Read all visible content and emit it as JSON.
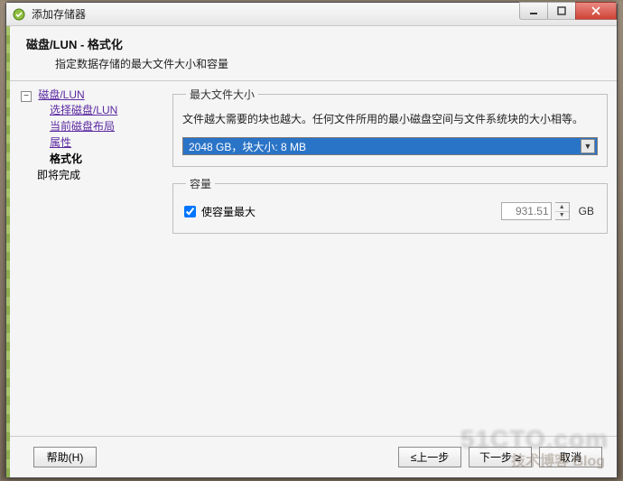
{
  "window": {
    "title": "添加存储器"
  },
  "header": {
    "title": "磁盘/LUN - 格式化",
    "subtitle": "指定数据存储的最大文件大小和容量"
  },
  "nav": {
    "root": "磁盘/LUN",
    "items": [
      {
        "label": "选择磁盘/LUN",
        "type": "link"
      },
      {
        "label": "当前磁盘布局",
        "type": "link"
      },
      {
        "label": "属性",
        "type": "link"
      },
      {
        "label": "格式化",
        "type": "bold"
      }
    ],
    "next": "即将完成"
  },
  "maxfile": {
    "legend": "最大文件大小",
    "desc": "文件越大需要的块也越大。任何文件所用的最小磁盘空间与文件系统块的大小相等。",
    "selected": "2048 GB，块大小: 8 MB"
  },
  "capacity": {
    "legend": "容量",
    "checkbox_label": "使容量最大",
    "checked": true,
    "value": "931.51",
    "unit": "GB"
  },
  "buttons": {
    "help": "帮助(H)",
    "back": "≤上一步",
    "next": "下一步 ≥",
    "cancel": "取消"
  },
  "watermark": {
    "main": "51CTO.com",
    "sub": "技术博客 Blog"
  }
}
